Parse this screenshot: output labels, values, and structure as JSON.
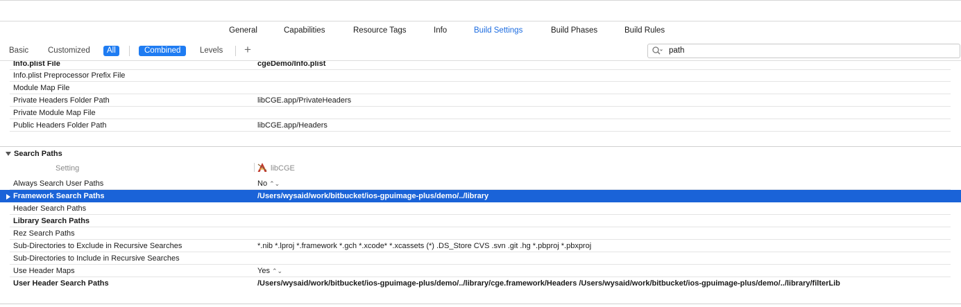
{
  "tabs": [
    {
      "label": "General"
    },
    {
      "label": "Capabilities"
    },
    {
      "label": "Resource Tags"
    },
    {
      "label": "Info"
    },
    {
      "label": "Build Settings"
    },
    {
      "label": "Build Phases"
    },
    {
      "label": "Build Rules"
    }
  ],
  "active_tab": "Build Settings",
  "filter": {
    "basic": "Basic",
    "customized": "Customized",
    "all": "All",
    "combined": "Combined",
    "levels": "Levels",
    "add_icon": "+"
  },
  "search": {
    "value": "path",
    "icon": "search-icon"
  },
  "packaging_rows": [
    {
      "name": "Info.plist File",
      "value": "cgeDemo/Info.plist",
      "bold": true
    },
    {
      "name": "Info.plist Preprocessor Prefix File",
      "value": ""
    },
    {
      "name": "Module Map File",
      "value": ""
    },
    {
      "name": "Private Headers Folder Path",
      "value": "libCGE.app/PrivateHeaders"
    },
    {
      "name": "Private Module Map File",
      "value": ""
    },
    {
      "name": "Public Headers Folder Path",
      "value": "libCGE.app/Headers"
    }
  ],
  "search_paths": {
    "title": "Search Paths",
    "column_setting": "Setting",
    "column_target": "libCGE",
    "target_icon": "app-target-icon",
    "rows": [
      {
        "name": "Always Search User Paths",
        "value": "No",
        "stepper": "⌃⌄"
      },
      {
        "name": "Framework Search Paths",
        "value": "/Users/wysaid/work/bitbucket/ios-gpuimage-plus/demo/../library",
        "bold": true,
        "selected": true
      },
      {
        "name": "Header Search Paths",
        "value": ""
      },
      {
        "name": "Library Search Paths",
        "value": "",
        "bold": true
      },
      {
        "name": "Rez Search Paths",
        "value": ""
      },
      {
        "name": "Sub-Directories to Exclude in Recursive Searches",
        "value": "*.nib *.lproj *.framework *.gch *.xcode* *.xcassets (*) .DS_Store CVS .svn .git .hg *.pbproj *.pbxproj"
      },
      {
        "name": "Sub-Directories to Include in Recursive Searches",
        "value": ""
      },
      {
        "name": "Use Header Maps",
        "value": "Yes",
        "stepper": "⌃⌄"
      },
      {
        "name": "User Header Search Paths",
        "value": "/Users/wysaid/work/bitbucket/ios-gpuimage-plus/demo/../library/cge.framework/Headers /Users/wysaid/work/bitbucket/ios-gpuimage-plus/demo/../library/filterLib",
        "bold": true
      }
    ]
  },
  "colors": {
    "accent": "#1c6ce0",
    "selection": "#1a63d8",
    "filter_selected": "#1f7cf2"
  }
}
